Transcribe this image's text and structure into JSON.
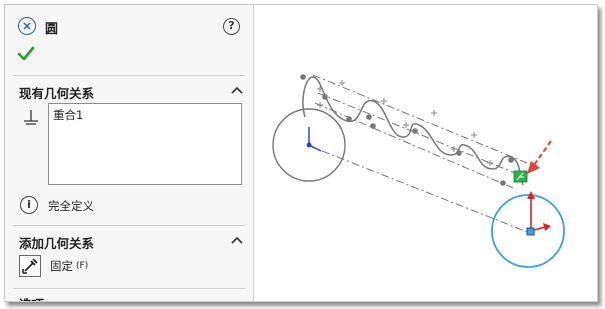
{
  "panel": {
    "title": "圆",
    "existing_relations": {
      "title": "现有几何关系",
      "items": [
        "重合1"
      ]
    },
    "status_text": "完全定义",
    "add_relations": {
      "title": "添加几何关系",
      "fix_label": "固定",
      "fix_shortcut": "(F)"
    },
    "options_partial": "选项"
  },
  "icons": {
    "close": "close-icon",
    "help": "help-icon",
    "ok": "checkmark-icon",
    "collapse": "chevron-up-icon",
    "relation": "coincident-relation-icon",
    "info": "info-icon",
    "fix": "fix-anchor-icon"
  },
  "colors": {
    "ok_green": "#22a02a",
    "selected_circle": "#3aa0e0",
    "sketch_gray": "#777777",
    "origin_blue": "#2a3fbf",
    "axis_red": "#e02020",
    "arrow_red": "#e04040",
    "coincident_badge": "#2bb34a"
  }
}
